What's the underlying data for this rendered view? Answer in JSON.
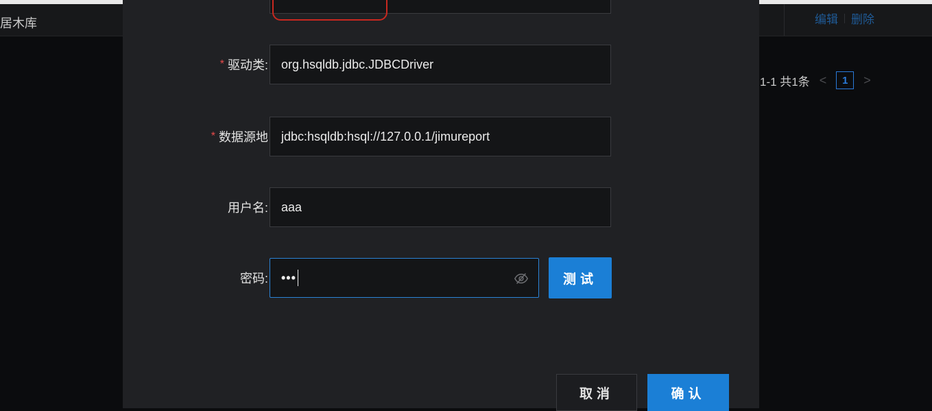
{
  "background": {
    "row_text": "居木库",
    "actions": {
      "edit": "编辑",
      "delete": "删除"
    },
    "pager": {
      "summary": "1-1 共1条",
      "prev": "<",
      "page": "1",
      "next": ">"
    }
  },
  "modal": {
    "fields": [
      {
        "required": true,
        "label": "驱动类:",
        "value": "org.hsqldb.jdbc.JDBCDriver"
      },
      {
        "required": true,
        "label": "数据源地",
        "value": "jdbc:hsqldb:hsql://127.0.0.1/jimureport"
      },
      {
        "required": false,
        "label": "用户名:",
        "value": "aaa"
      }
    ],
    "password": {
      "label": "密码:",
      "value_masked": "•••",
      "eye_icon": "eye-off-icon"
    },
    "buttons": {
      "test": "测试",
      "cancel": "取消",
      "ok": "确认"
    }
  },
  "colors": {
    "primary": "#1b7fd6",
    "required": "#e84a4a",
    "highlight": "#c8281f",
    "modal_bg": "#202124",
    "input_bg": "#141517"
  }
}
